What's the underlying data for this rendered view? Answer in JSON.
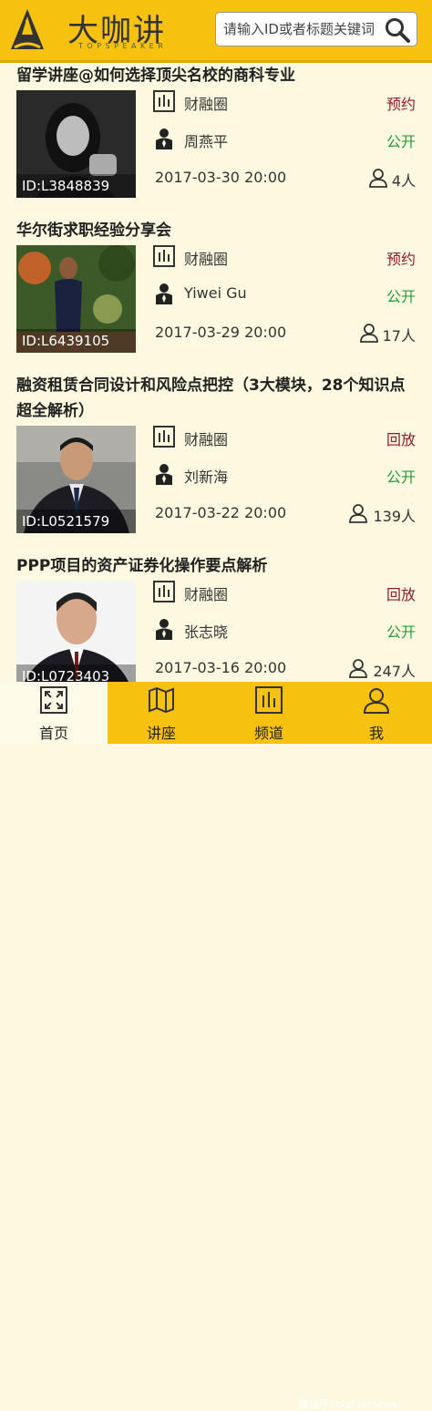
{
  "header": {
    "logo_text": "大咖讲",
    "logo_sub": "TOPSPEAKER",
    "search_placeholder": "请输入ID或者标题关键词"
  },
  "colors": {
    "accent": "#f7c20f",
    "background": "#fdf9e1",
    "status_reserve": "#8c1c2a",
    "status_public": "#2a9a3a"
  },
  "lectures": [
    {
      "title": "留学讲座@如何选择顶尖名校的商科专业",
      "id_label": "ID:L3848839",
      "channel": "财融圈",
      "speaker": "周燕平",
      "status": "预约",
      "access": "公开",
      "time": "2017-03-30 20:00",
      "count": "4人"
    },
    {
      "title": "华尔街求职经验分享会",
      "id_label": "ID:L6439105",
      "channel": "财融圈",
      "speaker": "Yiwei Gu",
      "status": "预约",
      "access": "公开",
      "time": "2017-03-29 20:00",
      "count": "17人"
    },
    {
      "title": "融资租赁合同设计和风险点把控（3大模块，28个知识点超全解析）",
      "id_label": "ID:L0521579",
      "channel": "财融圈",
      "speaker": "刘新海",
      "status": "回放",
      "access": "公开",
      "time": "2017-03-22 20:00",
      "count": "139人"
    },
    {
      "title": "PPP项目的资产证券化操作要点解析",
      "id_label": "ID:L0723403",
      "channel": "财融圈",
      "speaker": "张志晓",
      "status": "回放",
      "access": "公开",
      "time": "2017-03-16 20:00",
      "count": "247人"
    }
  ],
  "tabs": [
    {
      "label": "首页",
      "icon": "expand-icon",
      "active": true
    },
    {
      "label": "讲座",
      "icon": "map-icon",
      "active": false
    },
    {
      "label": "频道",
      "icon": "chart-icon",
      "active": false
    },
    {
      "label": "我",
      "icon": "user-icon",
      "active": false
    }
  ],
  "watermark": "微信号: bigfournews"
}
